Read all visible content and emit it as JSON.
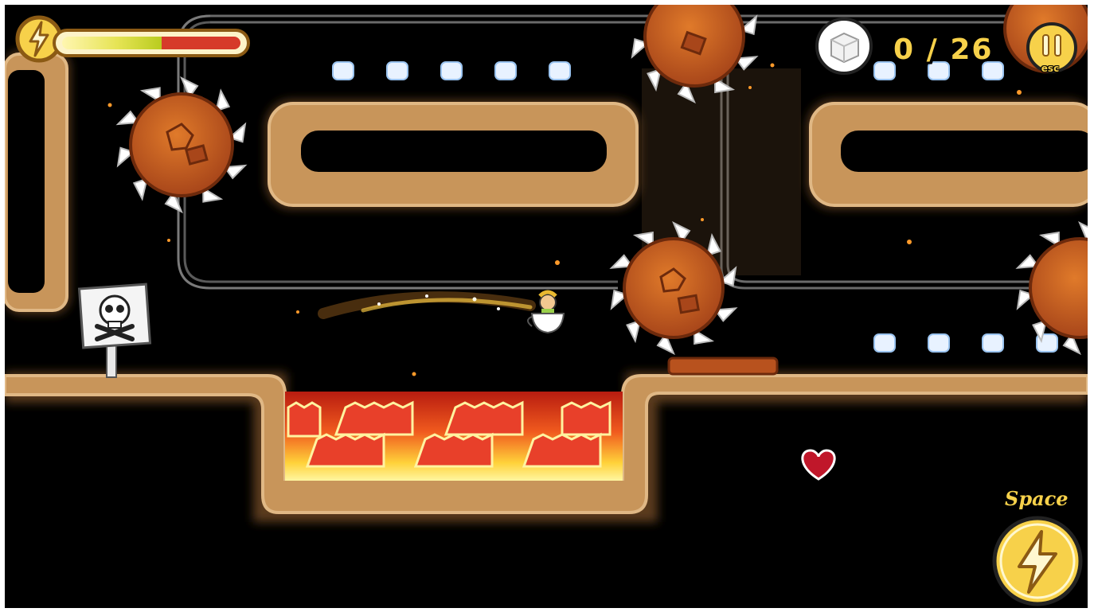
{
  "hud": {
    "energy_fraction": 0.56,
    "sugar_collected": "0",
    "sugar_separator": "/",
    "sugar_total": "26",
    "pause_key_label": "esc",
    "boost_key_label": "Space"
  },
  "icons": {
    "energy": "lightning-bolt-icon",
    "sugar": "sugar-cube-icon",
    "pause": "pause-icon",
    "boost": "lightning-bolt-icon",
    "danger_sign": "skull-crossbones-icon",
    "heart": "heart-icon"
  },
  "colors": {
    "background": "#000000",
    "dirt": "#c8955a",
    "saw": "#c65a1e",
    "lava": "#e8402a",
    "hud_gold": "#f7d14a",
    "energy_empty": "#d63a2a",
    "heart": "#c0172a"
  }
}
